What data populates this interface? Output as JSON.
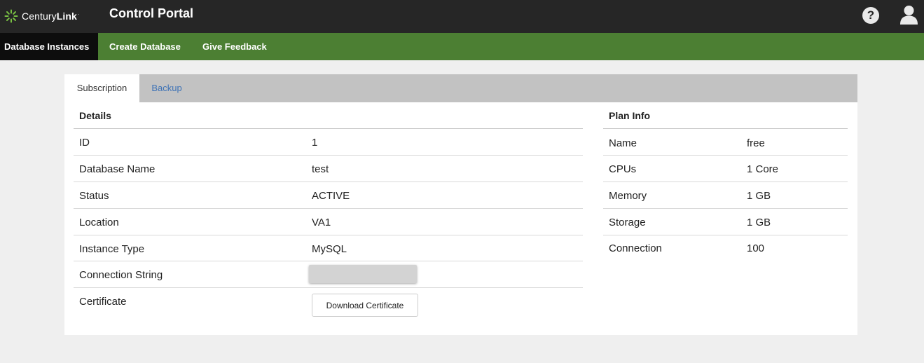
{
  "brand": {
    "logo_name_regular": "Century",
    "logo_name_bold": "Link",
    "logo_mark": "·",
    "app_title": "Control Portal",
    "accent_color": "#4c7f33",
    "header_color": "#262626",
    "logo_icon": "sunburst-logo-icon"
  },
  "header_icons": {
    "help": "?",
    "help_icon": "help-circle-icon",
    "user_icon": "user-silhouette-icon"
  },
  "nav": {
    "items": [
      {
        "label": "Database Instances",
        "active": true
      },
      {
        "label": "Create Database",
        "active": false
      },
      {
        "label": "Give Feedback",
        "active": false
      }
    ]
  },
  "tabs": [
    {
      "label": "Subscription",
      "active": true
    },
    {
      "label": "Backup",
      "active": false
    }
  ],
  "details": {
    "title": "Details",
    "rows": [
      {
        "label": "ID",
        "value": "1"
      },
      {
        "label": "Database Name",
        "value": "test"
      },
      {
        "label": "Status",
        "value": "ACTIVE"
      },
      {
        "label": "Location",
        "value": "VA1"
      },
      {
        "label": "Instance Type",
        "value": "MySQL"
      },
      {
        "label": "Connection String",
        "value": ""
      },
      {
        "label": "Certificate",
        "value": ""
      }
    ],
    "download_button": "Download Certificate"
  },
  "plan": {
    "title": "Plan Info",
    "rows": [
      {
        "label": "Name",
        "value": "free"
      },
      {
        "label": "CPUs",
        "value": "1 Core"
      },
      {
        "label": "Memory",
        "value": "1 GB"
      },
      {
        "label": "Storage",
        "value": "1 GB"
      },
      {
        "label": "Connection",
        "value": "100"
      }
    ]
  }
}
